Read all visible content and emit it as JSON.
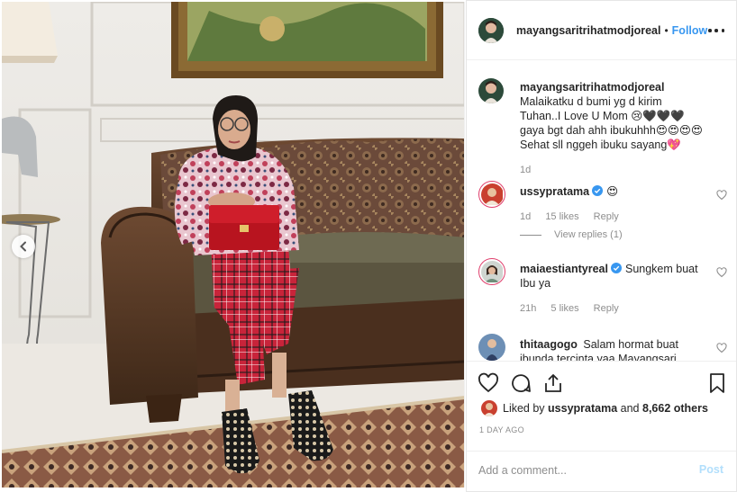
{
  "post": {
    "username": "mayangsaritrihatmodjoreal",
    "follow_label": "Follow",
    "header_separator": "•",
    "more_icon": "more-options-icon"
  },
  "caption": {
    "username": "mayangsaritrihatmodjoreal",
    "text": "Malaikatku d bumi yg d kirim Tuhan..I Love U Mom 😢🖤🖤🖤 gaya bgt dah ahh ibukuhhh😍😍😍😍 Sehat sll nggeh ibuku sayang💖",
    "age": "1d"
  },
  "comments": [
    {
      "username": "ussypratama",
      "verified": true,
      "text": "😍",
      "age": "1d",
      "likes": "15 likes",
      "reply_label": "Reply",
      "view_replies": "View replies (1)"
    },
    {
      "username": "maiaestiantyreal",
      "verified": true,
      "text": "Sungkem buat Ibu ya",
      "age": "21h",
      "likes": "5 likes",
      "reply_label": "Reply"
    },
    {
      "username": "thitaagogo",
      "verified": false,
      "text": "Salam hormat buat ibunda tercinta yaa Mayangsari"
    }
  ],
  "likes": {
    "prefix": "Liked by",
    "user": "ussypratama",
    "connector": "and",
    "others": "8,662 others"
  },
  "timestamp": "1 DAY AGO",
  "add_comment": {
    "placeholder": "Add a comment...",
    "post_label": "Post"
  },
  "colors": {
    "accent": "#3897f0",
    "post_disabled": "#b2dffc",
    "muted": "#8e8e8e",
    "text": "#262626",
    "story_ring": "#e0406d"
  }
}
